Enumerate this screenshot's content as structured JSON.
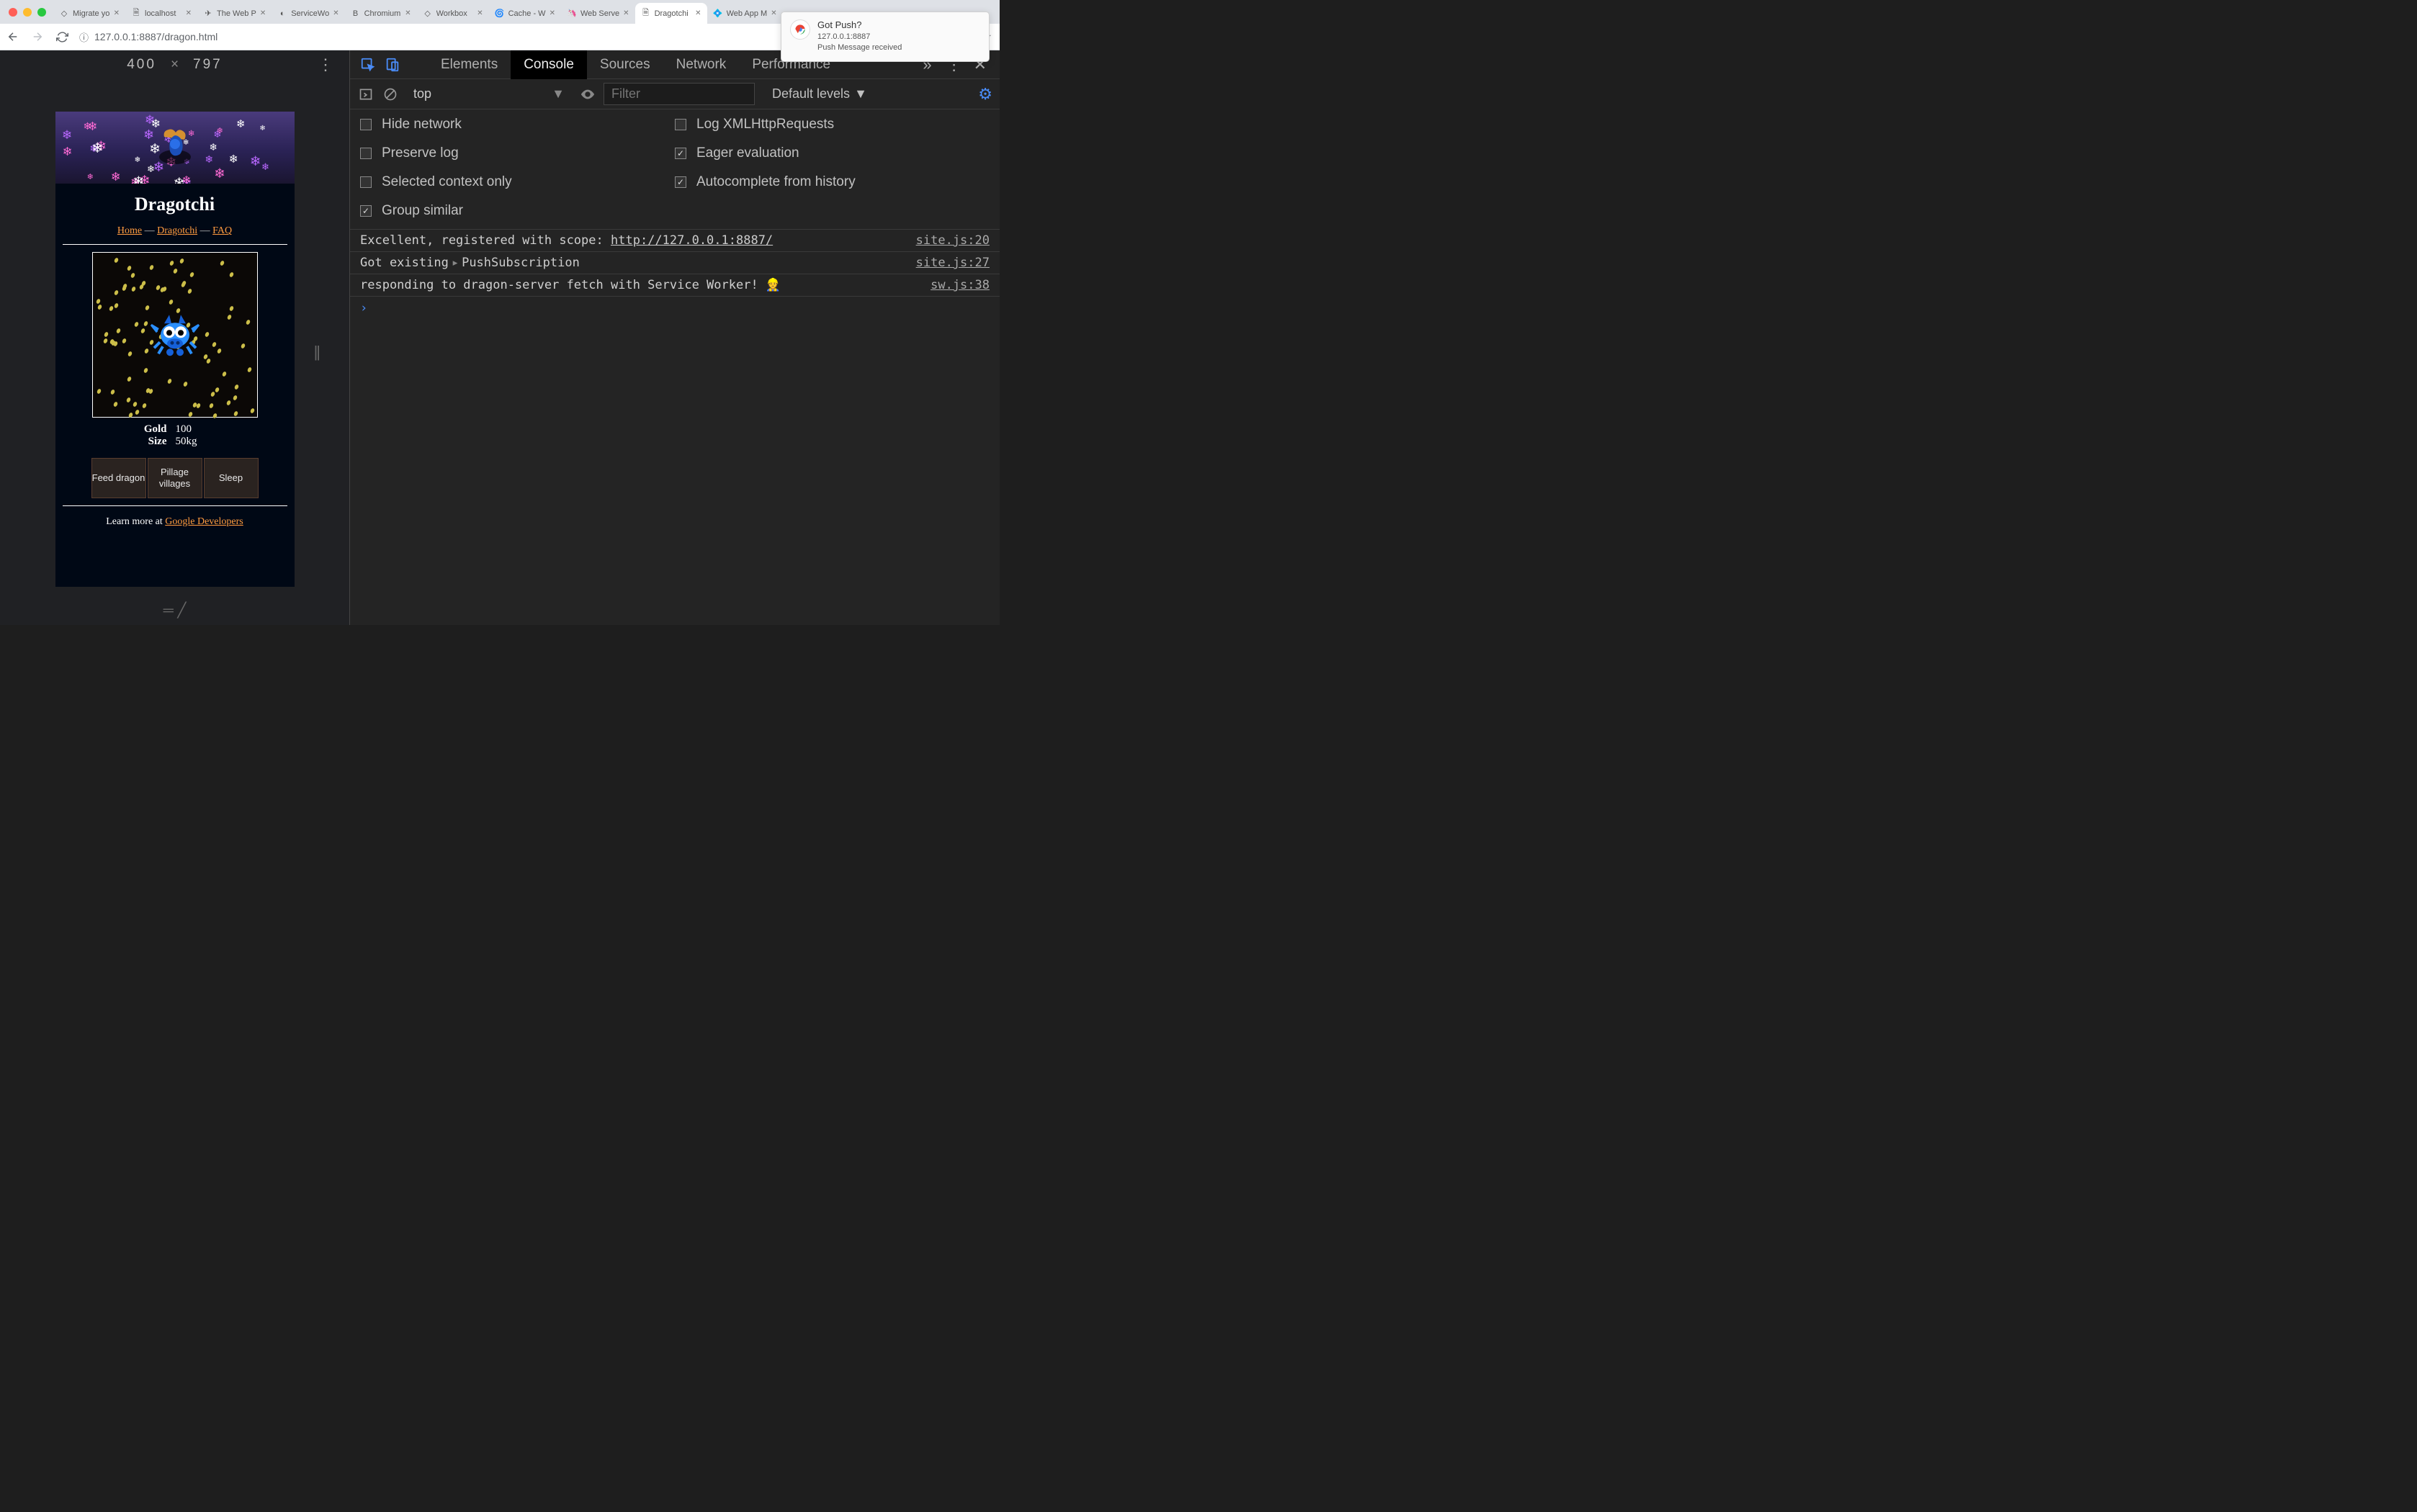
{
  "browser": {
    "tabs": [
      {
        "title": "Migrate yo",
        "icon": "◇"
      },
      {
        "title": "localhost",
        "icon": "🗎"
      },
      {
        "title": "The Web P",
        "icon": "✈"
      },
      {
        "title": "ServiceWo",
        "icon": "◐"
      },
      {
        "title": "Chromium",
        "icon": "B"
      },
      {
        "title": "Workbox",
        "icon": "◇"
      },
      {
        "title": "Cache - W",
        "icon": "🌀"
      },
      {
        "title": "Web Serve",
        "icon": "🦄"
      },
      {
        "title": "Dragotchi",
        "icon": "🗎",
        "active": true
      },
      {
        "title": "Web App M",
        "icon": "💠"
      }
    ],
    "url": "127.0.0.1:8887/dragon.html"
  },
  "notification": {
    "title": "Got Push?",
    "origin": "127.0.0.1:8887",
    "body": "Push Message received"
  },
  "device": {
    "width": "400",
    "height": "797"
  },
  "page": {
    "title": "Dragotchi",
    "nav": {
      "home": "Home",
      "dragotchi": "Dragotchi",
      "faq": "FAQ",
      "sep": "—"
    },
    "stats": {
      "gold_label": "Gold",
      "gold_val": "100",
      "size_label": "Size",
      "size_val": "50kg"
    },
    "buttons": {
      "feed": "Feed dragon",
      "pillage": "Pillage villages",
      "sleep": "Sleep"
    },
    "learn_prefix": "Learn more at ",
    "learn_link": "Google Developers"
  },
  "devtools": {
    "tabs": {
      "elements": "Elements",
      "console": "Console",
      "sources": "Sources",
      "network": "Network",
      "performance": "Performance"
    },
    "toolbar": {
      "context": "top",
      "filter_placeholder": "Filter",
      "levels": "Default levels"
    },
    "settings": {
      "hide_network": "Hide network",
      "log_xhr": "Log XMLHttpRequests",
      "preserve": "Preserve log",
      "eager": "Eager evaluation",
      "selected_ctx": "Selected context only",
      "autocomplete": "Autocomplete from history",
      "group": "Group similar"
    },
    "logs": [
      {
        "msg": "Excellent, registered with scope: ",
        "url": "http://127.0.0.1:8887/",
        "src": "site.js:20"
      },
      {
        "msg": "Got existing",
        "obj": "PushSubscription",
        "src": "site.js:27"
      },
      {
        "msg": "responding to dragon-server fetch with Service Worker! 👷",
        "src": "sw.js:38"
      }
    ]
  }
}
